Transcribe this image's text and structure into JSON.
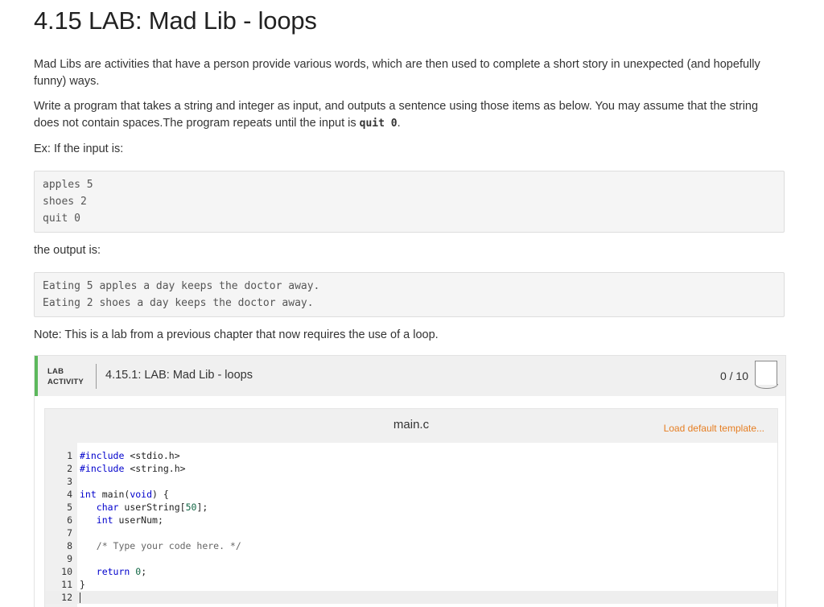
{
  "title": "4.15 LAB: Mad Lib - loops",
  "intro": "Mad Libs are activities that have a person provide various words, which are then used to complete a short story in unexpected (and hopefully funny) ways.",
  "instructions_before": "Write a program that takes a string and integer as input, and outputs a sentence using those items as below. You may assume that the string does not contain spaces.The program repeats until the input is ",
  "instructions_code": "quit 0",
  "instructions_after": ".",
  "example_label": "Ex: If the input is:",
  "example_input": [
    "apples 5",
    "shoes 2",
    "quit 0"
  ],
  "output_label": "the output is:",
  "example_output": [
    "Eating 5 apples a day keeps the doctor away.",
    "Eating 2 shoes a day keeps the doctor away."
  ],
  "note": "Note: This is a lab from a previous chapter that now requires the use of a loop.",
  "lab": {
    "tag_line1": "LAB",
    "tag_line2": "ACTIVITY",
    "title": "4.15.1: LAB: Mad Lib - loops",
    "score": "0 / 10",
    "accent_color": "#5cb85c"
  },
  "editor": {
    "file_name": "main.c",
    "load_template": "Load default template...",
    "lines": [
      {
        "n": "1",
        "code": "#include <stdio.h>"
      },
      {
        "n": "2",
        "code": "#include <string.h>"
      },
      {
        "n": "3",
        "code": ""
      },
      {
        "n": "4",
        "code": "int main(void) {"
      },
      {
        "n": "5",
        "code": "   char userString[50];"
      },
      {
        "n": "6",
        "code": "   int userNum;"
      },
      {
        "n": "7",
        "code": ""
      },
      {
        "n": "8",
        "code": "   /* Type your code here. */"
      },
      {
        "n": "9",
        "code": ""
      },
      {
        "n": "10",
        "code": "   return 0;"
      },
      {
        "n": "11",
        "code": "}"
      },
      {
        "n": "12",
        "code": ""
      }
    ]
  }
}
